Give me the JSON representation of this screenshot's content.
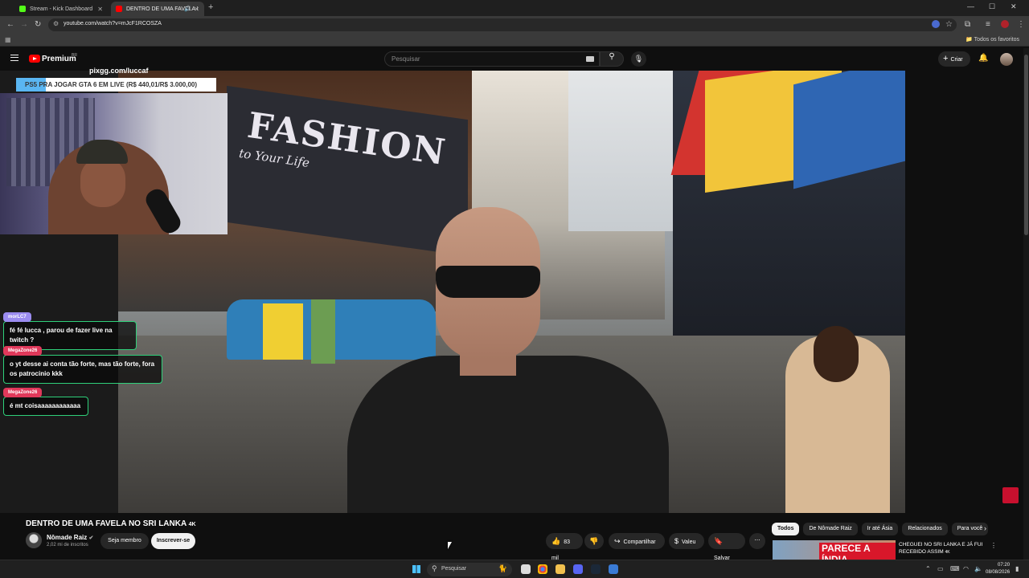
{
  "browser": {
    "tabs": [
      {
        "title": "Stream - Kick Dashboard",
        "active": false,
        "favicon_color": "#53fc18"
      },
      {
        "title": "DENTRO DE UMA FAVELA I",
        "active": true,
        "favicon_color": "#ff0000"
      }
    ],
    "url": "youtube.com/watch?v=mJcF1RCOSZA",
    "bookmarks_label": "Todos os favoritos"
  },
  "youtube": {
    "brand": "Premium",
    "brand_sup": "BR",
    "search_placeholder": "Pesquisar",
    "create_label": "Criar"
  },
  "stream_overlay": {
    "pix_text": "pixgg.com/luccaf",
    "goal_text": "PS5 PRA JOGAR GTA 6 EM LIVE (R$ 440,01/R$ 3.000,00)",
    "goal_progress": 0.1467,
    "chat": [
      {
        "user": "morLC7",
        "message": "fé fé lucca , parou de fazer live na twitch ?",
        "user_color": "#9b8cf0"
      },
      {
        "user": "MegaZone26",
        "message": "o yt desse ai conta tão forte, mas tão forte, fora os patrocinio kkk",
        "user_color": "#e0385a"
      },
      {
        "user": "MegaZone26",
        "message": "é mt coisaaaaaaaaaaaa",
        "user_color": "#e0385a"
      }
    ]
  },
  "scene": {
    "sign_main": "FASHION",
    "sign_sub": "to Your Life"
  },
  "video": {
    "title": "DENTRO DE UMA FAVELA NO SRI LANKA",
    "resolution_badge": "4K",
    "channel_name": "Nômade Raiz",
    "channel_subs": "2,02 mi de inscritos",
    "join_label": "Seja membro",
    "subscribe_label": "Inscrever-se",
    "likes": "83 mil",
    "share_label": "Compartilhar",
    "thanks_label": "Valeu",
    "save_label": "Salvar"
  },
  "recommendations": {
    "chips": [
      "Todos",
      "De Nômade Raiz",
      "Ir até Ásia",
      "Relacionados",
      "Para você"
    ],
    "active_chip": "Todos",
    "first": {
      "thumb_text": "PARECE A ÍNDIA",
      "title": "CHEGUEI NO SRI LANKA E JÁ FUI RECEBIDO ASSIM",
      "badge": "4K"
    }
  },
  "taskbar": {
    "search_placeholder": "Pesquisar",
    "time": "07:20",
    "date": "08/08/2026"
  }
}
